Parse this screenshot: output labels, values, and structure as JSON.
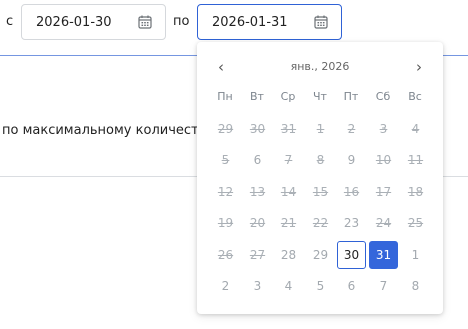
{
  "filter": {
    "from_label": "с",
    "to_label": "по",
    "from_value": "2026-01-30",
    "to_value": "2026-01-31",
    "from_icon": "calendar-icon",
    "to_icon": "calendar-icon"
  },
  "background_text": "по максимальному количеству п",
  "datepicker": {
    "month_label": "янв., 2026",
    "prev_icon": "‹",
    "next_icon": "›",
    "weekdays": [
      "Пн",
      "Вт",
      "Ср",
      "Чт",
      "Пт",
      "Сб",
      "Вс"
    ],
    "weeks": [
      [
        {
          "d": "29",
          "s": "disabled"
        },
        {
          "d": "30",
          "s": "disabled"
        },
        {
          "d": "31",
          "s": "disabled"
        },
        {
          "d": "1",
          "s": "disabled"
        },
        {
          "d": "2",
          "s": "disabled"
        },
        {
          "d": "3",
          "s": "disabled"
        },
        {
          "d": "4",
          "s": "disabled"
        }
      ],
      [
        {
          "d": "5",
          "s": "disabled"
        },
        {
          "d": "6",
          "s": "other"
        },
        {
          "d": "7",
          "s": "disabled"
        },
        {
          "d": "8",
          "s": "disabled"
        },
        {
          "d": "9",
          "s": "other"
        },
        {
          "d": "10",
          "s": "disabled"
        },
        {
          "d": "11",
          "s": "disabled"
        }
      ],
      [
        {
          "d": "12",
          "s": "disabled"
        },
        {
          "d": "13",
          "s": "disabled"
        },
        {
          "d": "14",
          "s": "disabled"
        },
        {
          "d": "15",
          "s": "disabled"
        },
        {
          "d": "16",
          "s": "disabled"
        },
        {
          "d": "17",
          "s": "disabled"
        },
        {
          "d": "18",
          "s": "disabled"
        }
      ],
      [
        {
          "d": "19",
          "s": "disabled"
        },
        {
          "d": "20",
          "s": "disabled"
        },
        {
          "d": "21",
          "s": "disabled"
        },
        {
          "d": "22",
          "s": "disabled"
        },
        {
          "d": "23",
          "s": "other"
        },
        {
          "d": "24",
          "s": "disabled"
        },
        {
          "d": "25",
          "s": "disabled"
        }
      ],
      [
        {
          "d": "26",
          "s": "disabled"
        },
        {
          "d": "27",
          "s": "disabled"
        },
        {
          "d": "28",
          "s": "other"
        },
        {
          "d": "29",
          "s": "other"
        },
        {
          "d": "30",
          "s": "current"
        },
        {
          "d": "31",
          "s": "selected"
        },
        {
          "d": "1",
          "s": "other"
        }
      ],
      [
        {
          "d": "2",
          "s": "other"
        },
        {
          "d": "3",
          "s": "other"
        },
        {
          "d": "4",
          "s": "other"
        },
        {
          "d": "5",
          "s": "other"
        },
        {
          "d": "6",
          "s": "other"
        },
        {
          "d": "7",
          "s": "other"
        },
        {
          "d": "8",
          "s": "other"
        }
      ]
    ]
  },
  "colors": {
    "accent": "#3466db",
    "border_active": "#2f62d6",
    "divider_blue": "#7596e1"
  }
}
